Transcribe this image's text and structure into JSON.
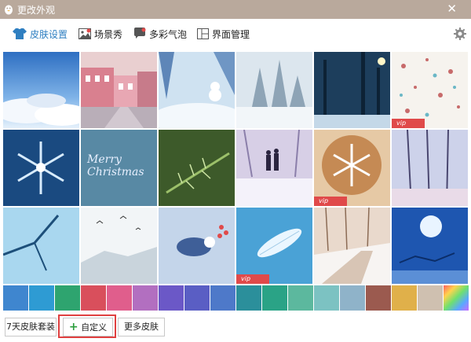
{
  "window": {
    "title": "更改外观"
  },
  "tabs": [
    {
      "label": "皮肤设置",
      "icon": "shirt-icon",
      "active": true
    },
    {
      "label": "场景秀",
      "icon": "picture-icon",
      "active": false
    },
    {
      "label": "多彩气泡",
      "icon": "bubble-icon",
      "active": false
    },
    {
      "label": "界面管理",
      "icon": "layout-icon",
      "active": false
    }
  ],
  "skins": {
    "row1": [
      "sky-clouds",
      "pink-street",
      "snow-cabin",
      "snow-trees",
      "night-blue",
      "snowflake-pattern"
    ],
    "row2": [
      "ice-snowflake",
      "merry-christmas",
      "pine-branch",
      "couple-snow",
      "latte-art",
      "pink-trees"
    ],
    "row3": [
      "blue-branch",
      "snow-birds",
      "snow-bird",
      "white-feather",
      "snow-boardwalk",
      "moon-sleigh"
    ],
    "merry_text": "Merry Christmas",
    "vip_label": "vip"
  },
  "swatches": [
    "#3f86cf",
    "#2e9bd3",
    "#2ea46f",
    "#d94f5c",
    "#e05e8c",
    "#b26fc0",
    "#6b58c7",
    "#5a5ec4",
    "#4e79c9",
    "#2b8f9b",
    "#2aa386",
    "#5cb89e",
    "#7cc2c2",
    "#8fb3c9",
    "#9b5a4f",
    "#e0b04a",
    "#cfc0b0",
    "#7fd0ff"
  ],
  "footer": {
    "skin_pack_label": "7天皮肤套装",
    "custom_label": "自定义",
    "more_label": "更多皮肤"
  },
  "colors": {
    "accent": "#2f7fc1",
    "titlebar": "#b9a99c",
    "highlight": "#e04040"
  }
}
